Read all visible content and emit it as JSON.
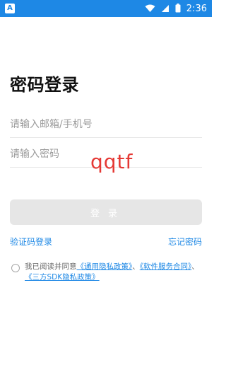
{
  "status_bar": {
    "app_icon_letter": "A",
    "time": "2:36"
  },
  "page": {
    "title": "密码登录",
    "email_placeholder": "请输入邮箱/手机号",
    "password_placeholder": "请输入密码",
    "overlay_text": "qqtf",
    "login_button": "登录",
    "code_login_link": "验证码登录",
    "forgot_password_link": "忘记密码"
  },
  "agreement": {
    "prefix": "我已阅读并同意",
    "link1": "《通用隐私政策》",
    "sep1": "、",
    "link2": "《软件服务合同》",
    "sep2": "、",
    "link3": "《三方SDK隐私政策》"
  },
  "colors": {
    "accent": "#1e88e5",
    "overlay": "#e53935"
  }
}
